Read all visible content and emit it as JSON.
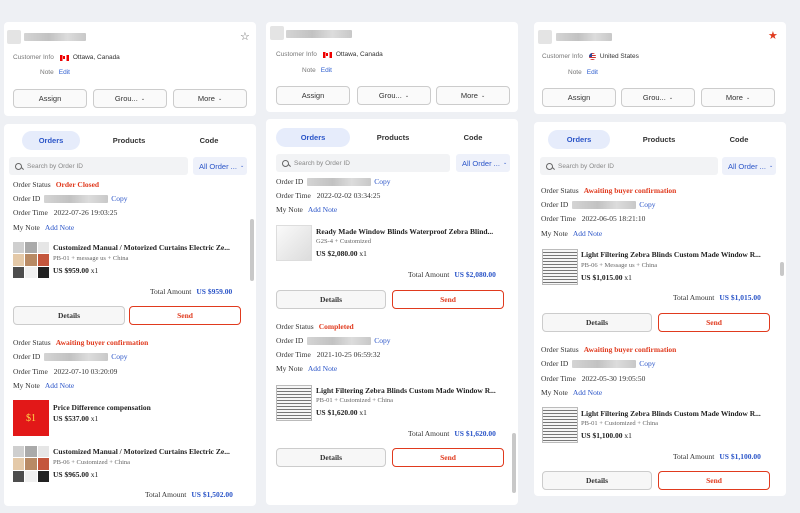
{
  "colors": {
    "accent": "#2b55c8",
    "danger": "#e03a1e"
  },
  "header": {
    "customer_info_label": "Customer Info",
    "note_label": "Note",
    "edit_label": "Edit",
    "assign_label": "Assign",
    "group_label": "Grou...",
    "more_label": "More"
  },
  "tabs": {
    "orders": "Orders",
    "products": "Products",
    "code": "Code"
  },
  "search": {
    "placeholder": "Search by Order ID",
    "filter": "All Order ..."
  },
  "labels": {
    "order_status": "Order Status",
    "order_id": "Order ID",
    "order_time": "Order Time",
    "my_note": "My Note",
    "add_note": "Add Note",
    "copy": "Copy",
    "total_amount": "Total Amount",
    "details": "Details",
    "send": "Send"
  },
  "columns": [
    {
      "location": "Ottawa, Canada",
      "starred": false,
      "orders": [
        {
          "status": "Order Closed",
          "time": "2022-07-26 19:03:25",
          "products": [
            {
              "title": "Customized Manual / Motorized Curtains Electric Ze...",
              "sub": "PB-01 + message us + China",
              "price": "US $959.00",
              "qty": "x1"
            }
          ],
          "total": "US $959.00"
        },
        {
          "status": "Awaiting buyer confirmation",
          "time": "2022-07-10 03:20:09",
          "products": [
            {
              "title": "Price Difference compensation",
              "sub": "",
              "price": "US $537.00",
              "qty": "x1",
              "badge": "$1"
            },
            {
              "title": "Customized Manual / Motorized Curtains Electric Ze...",
              "sub": "PB-06 + Customized + China",
              "price": "US $965.00",
              "qty": "x1"
            }
          ],
          "total": "US $1,502.00"
        }
      ]
    },
    {
      "location": "Ottawa, Canada",
      "starred": false,
      "orders": [
        {
          "status": "",
          "time": "2022-02-02 03:34:25",
          "products": [
            {
              "title": "Ready Made Window Blinds Waterproof Zebra Blind...",
              "sub": "G2S-4 + Customized",
              "price": "US $2,080.00",
              "qty": "x1"
            }
          ],
          "total": "US $2,080.00"
        },
        {
          "status": "Completed",
          "time": "2021-10-25 06:59:32",
          "products": [
            {
              "title": "Light Filtering Zebra Blinds Custom Made Window R...",
              "sub": "PB-01 + Customized + China",
              "price": "US $1,620.00",
              "qty": "x1"
            }
          ],
          "total": "US $1,620.00"
        }
      ]
    },
    {
      "location": "United States",
      "starred": true,
      "orders": [
        {
          "status": "Awaiting buyer confirmation",
          "time": "2022-06-05 18:21:10",
          "products": [
            {
              "title": "Light Filtering Zebra Blinds Custom Made Window R...",
              "sub": "PB-06 + Message us + China",
              "price": "US $1,015.00",
              "qty": "x1"
            }
          ],
          "total": "US $1,015.00"
        },
        {
          "status": "Awaiting buyer confirmation",
          "time": "2022-05-30 19:05:50",
          "products": [
            {
              "title": "Light Filtering Zebra Blinds Custom Made Window R...",
              "sub": "PB-01 + Customized + China",
              "price": "US $1,100.00",
              "qty": "x1"
            }
          ],
          "total": "US $1,100.00"
        }
      ]
    }
  ]
}
